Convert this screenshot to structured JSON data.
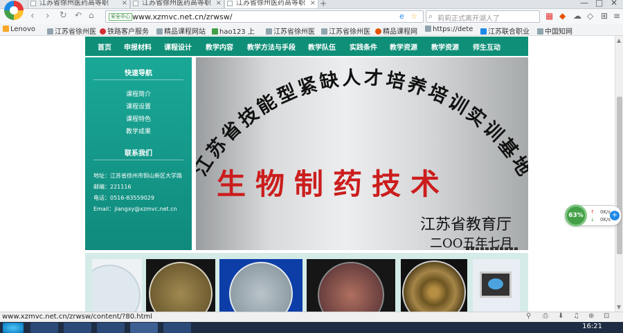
{
  "browser": {
    "tabs": [
      {
        "label": "江苏省徐州医药高等职",
        "active": false
      },
      {
        "label": "江苏省徐州医药高等职",
        "active": false
      },
      {
        "label": "江苏省徐州医药高等职",
        "active": true
      }
    ],
    "address": {
      "secure_badge": "安全中心",
      "url": "www.xzmvc.net.cn/zrwsw/"
    },
    "search": {
      "placeholder": "莉莉正式离开湖人了"
    },
    "bookmarks": [
      {
        "label": "Lenovo",
        "color": "#f9a825"
      },
      {
        "label": "江苏省徐州医",
        "color": "#90a4ae"
      },
      {
        "label": "铁路客户服务",
        "color": "#d32f2f"
      },
      {
        "label": "精品课程网站",
        "color": "#90a4ae"
      },
      {
        "label": "hao123 上",
        "color": "#43a047"
      },
      {
        "label": "江苏省徐州医",
        "color": "#90a4ae"
      },
      {
        "label": "江苏省徐州医",
        "color": "#90a4ae"
      },
      {
        "label": "精品课程网",
        "color": "#e65100"
      },
      {
        "label": "https://dete",
        "color": "#90a4ae"
      },
      {
        "label": "江苏联合职业",
        "color": "#1e88e5"
      },
      {
        "label": "中国知网",
        "color": "#90a4ae"
      }
    ]
  },
  "site": {
    "nav": [
      "首页",
      "申报材料",
      "课程设计",
      "教学内容",
      "教学方法与手段",
      "教学队伍",
      "实践条件",
      "教学资源",
      "教学资源",
      "师生互动"
    ],
    "sidebar": {
      "quick_title": "快速导航",
      "links": [
        "课程简介",
        "课程设置",
        "课程特色",
        "教学成果"
      ],
      "contact_title": "联系我们",
      "contact": [
        "地址：江苏省徐州市铜山新区大学路",
        "邮编：221116",
        "电话：0516-83559029",
        "Email：jiangxy@xzmvc.net.cn"
      ]
    },
    "banner": {
      "arc_title": "江苏省技能型紧缺人才培养培训实训基地",
      "main_title": "生物制药技术",
      "issuer": "江苏省教育厅",
      "date": "二OO五年七月"
    }
  },
  "float_widget": {
    "percent": "63%",
    "up": "0K/s",
    "down": "0K/s"
  },
  "status_bar": {
    "url": "www.xzmvc.net.cn/zrwsw/content/?80.html"
  },
  "taskbar": {
    "clock": "16:21"
  }
}
